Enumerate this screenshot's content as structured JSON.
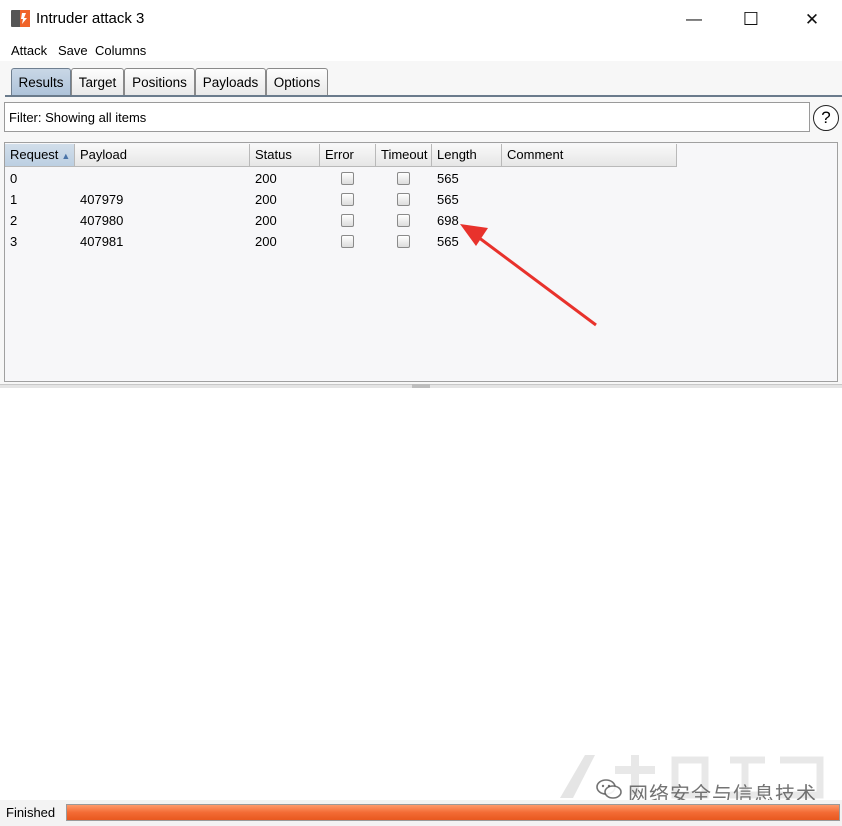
{
  "window": {
    "title": "Intruder attack 3",
    "minimize_glyph": "—",
    "maximize_glyph": "☐",
    "close_glyph": "✕"
  },
  "menu": {
    "items": [
      "Attack",
      "Save",
      "Columns"
    ]
  },
  "tabs": [
    {
      "label": "Results",
      "active": true
    },
    {
      "label": "Target",
      "active": false
    },
    {
      "label": "Positions",
      "active": false
    },
    {
      "label": "Payloads",
      "active": false
    },
    {
      "label": "Options",
      "active": false
    }
  ],
  "filter": {
    "text": "Filter: Showing all items",
    "help_glyph": "?"
  },
  "table": {
    "columns": [
      "Request",
      "Payload",
      "Status",
      "Error",
      "Timeout",
      "Length",
      "Comment"
    ],
    "sorted_column": "Request",
    "sort_glyph": "▲",
    "rows": [
      {
        "request": "0",
        "payload": "",
        "status": "200",
        "error": false,
        "timeout": false,
        "length": "565",
        "comment": ""
      },
      {
        "request": "1",
        "payload": "407979",
        "status": "200",
        "error": false,
        "timeout": false,
        "length": "565",
        "comment": ""
      },
      {
        "request": "2",
        "payload": "407980",
        "status": "200",
        "error": false,
        "timeout": false,
        "length": "698",
        "comment": ""
      },
      {
        "request": "3",
        "payload": "407981",
        "status": "200",
        "error": false,
        "timeout": false,
        "length": "565",
        "comment": ""
      }
    ]
  },
  "status": {
    "text": "Finished",
    "progress": 1.0,
    "progress_color": "#f36b35"
  },
  "annotation": {
    "arrow_color": "#e8322c"
  },
  "watermark": {
    "text": "网络安全与信息技术"
  }
}
